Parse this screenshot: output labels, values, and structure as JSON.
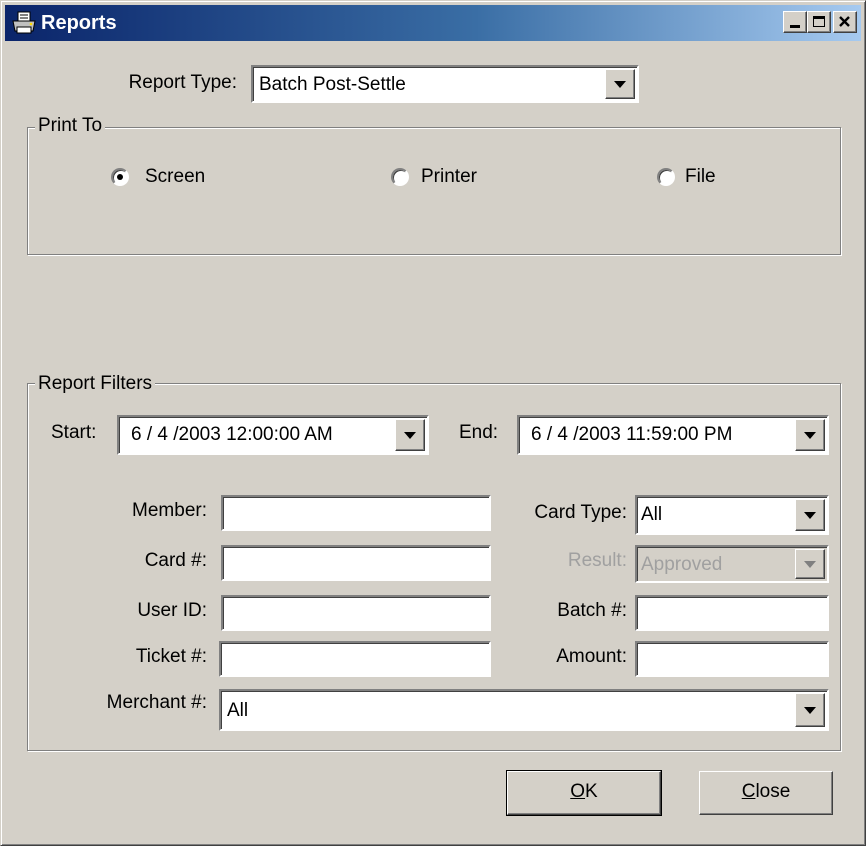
{
  "window": {
    "title": "Reports",
    "icon": "printer-icon"
  },
  "report_type": {
    "label": "Report Type:",
    "value": "Batch Post-Settle"
  },
  "print_to": {
    "legend": "Print To",
    "options": [
      {
        "label": "Screen",
        "selected": true
      },
      {
        "label": "Printer",
        "selected": false
      },
      {
        "label": "File",
        "selected": false
      }
    ]
  },
  "filters": {
    "legend": "Report Filters",
    "start": {
      "label": "Start:",
      "value": "6 / 4 /2003  12:00:00 AM"
    },
    "end": {
      "label": "End:",
      "value": "6 / 4 /2003  11:59:00 PM"
    },
    "member": {
      "label": "Member:",
      "value": ""
    },
    "card_number": {
      "label": "Card #:",
      "value": ""
    },
    "user_id": {
      "label": "User ID:",
      "value": ""
    },
    "ticket_number": {
      "label": "Ticket #:",
      "value": ""
    },
    "card_type": {
      "label": "Card Type:",
      "value": "All"
    },
    "result": {
      "label": "Result:",
      "value": "Approved",
      "disabled": true
    },
    "batch_number": {
      "label": "Batch #:",
      "value": ""
    },
    "amount": {
      "label": "Amount:",
      "value": ""
    },
    "merchant": {
      "label": "Merchant #:",
      "value": "All"
    }
  },
  "buttons": {
    "ok": {
      "mnemonic": "O",
      "rest": "K"
    },
    "close": {
      "mnemonic": "C",
      "rest": "lose"
    }
  },
  "colors": {
    "face": "#d4d0c8",
    "title_start": "#0a246a",
    "title_end": "#a6caf0",
    "disabled_text": "#a0a0a0"
  }
}
